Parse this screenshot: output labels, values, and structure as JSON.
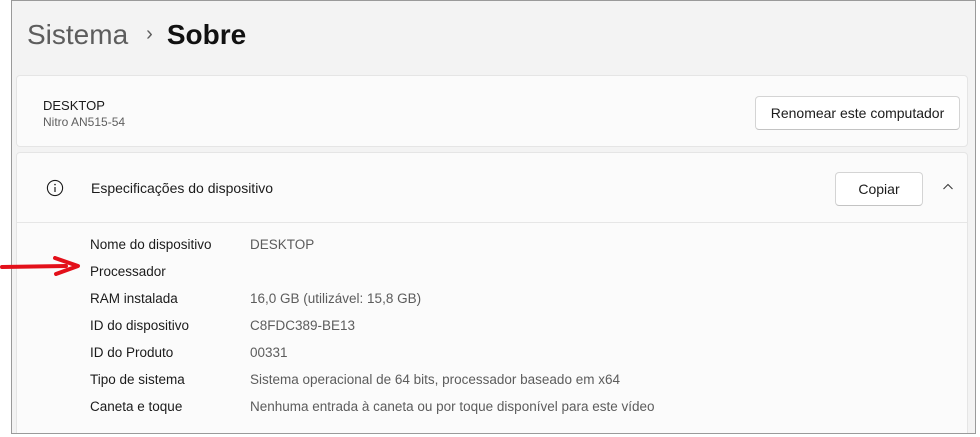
{
  "breadcrumb": {
    "parent": "Sistema",
    "separator": "›",
    "current": "Sobre"
  },
  "device_card": {
    "name": "DESKTOP",
    "model": "Nitro AN515-54",
    "rename_button": "Renomear este computador"
  },
  "specs": {
    "title": "Especificações do dispositivo",
    "copy_button": "Copiar",
    "rows": [
      {
        "label": "Nome do dispositivo",
        "value": "DESKTOP"
      },
      {
        "label": "Processador",
        "value": ""
      },
      {
        "label": "RAM instalada",
        "value": "16,0 GB (utilizável: 15,8 GB)"
      },
      {
        "label": "ID do dispositivo",
        "value": "C8FDC389-BE13"
      },
      {
        "label": "ID do Produto",
        "value": "00331"
      },
      {
        "label": "Tipo de sistema",
        "value": "Sistema operacional de 64 bits, processador baseado em x64"
      },
      {
        "label": "Caneta e toque",
        "value": "Nenhuma entrada à caneta ou por toque disponível para este vídeo"
      }
    ]
  },
  "icons": {
    "info": "info-icon",
    "chevron": "chevron-up-icon",
    "annotation": "red-arrow-icon"
  },
  "colors": {
    "annotation_arrow": "#e3101a",
    "background": "#f3f3f3",
    "card": "#fbfbfb"
  }
}
